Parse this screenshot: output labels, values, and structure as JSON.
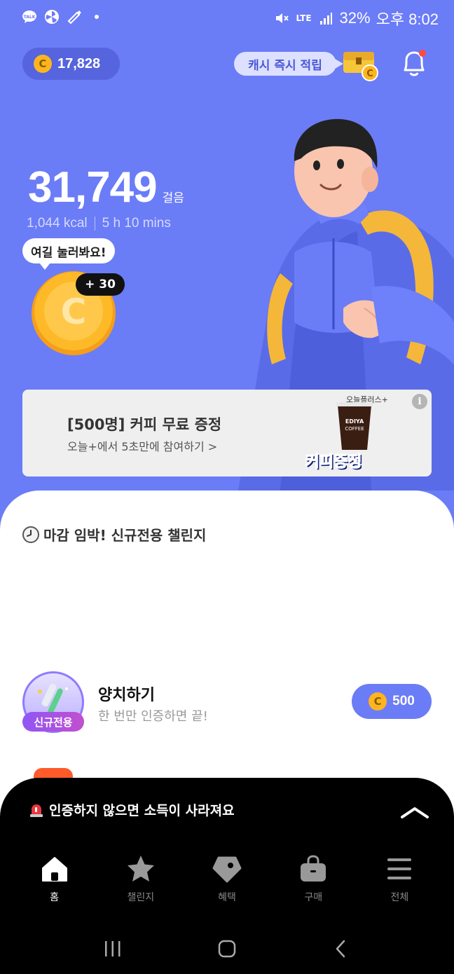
{
  "status_bar": {
    "battery": "32%",
    "time": "오후 8:02",
    "network": "LTE",
    "icons": [
      "talk-icon",
      "fan-icon",
      "brush-icon",
      "dot-icon",
      "mute-icon",
      "signal-icon"
    ]
  },
  "header": {
    "coin_symbol": "C",
    "coin_balance": "17,828",
    "cash_label": "캐시 즉시 적립"
  },
  "activity": {
    "steps": "31,749",
    "steps_unit": "걸음",
    "kcal": "1,044 kcal",
    "duration": "5 h 10 mins",
    "tip": "여길 눌러봐요!",
    "coin_letter": "C",
    "bonus": "+ 30"
  },
  "ad": {
    "title": "[500명] 커피 무료 증정",
    "subtitle": "오늘+에서 5초만에 참여하기 >",
    "brand": "오늘플러스+",
    "cup_text_1": "EDIYA",
    "cup_text_2": "COFFEE",
    "stamp": "커피증정",
    "info_symbol": "i"
  },
  "challenge_section": {
    "title": "마감 임박! 신규전용 챌린지",
    "items": [
      {
        "badge": "신규전용",
        "title": "양치하기",
        "subtitle": "한 번만 인증하면 끝!",
        "reward_symbol": "C",
        "reward": "500"
      }
    ]
  },
  "notice": {
    "text": "인증하지 않으면 소득이 사라져요"
  },
  "nav": {
    "items": [
      {
        "label": "홈",
        "icon": "home-icon",
        "active": true
      },
      {
        "label": "챌린지",
        "icon": "star-icon",
        "active": false
      },
      {
        "label": "혜택",
        "icon": "tag-icon",
        "active": false
      },
      {
        "label": "구매",
        "icon": "bag-icon",
        "active": false
      },
      {
        "label": "전체",
        "icon": "menu-icon",
        "active": false
      }
    ]
  },
  "colors": {
    "background": "#6B7CF7",
    "coin": "#FDB51F",
    "accent": "#6B7CF7",
    "badge": "#9056F5"
  }
}
